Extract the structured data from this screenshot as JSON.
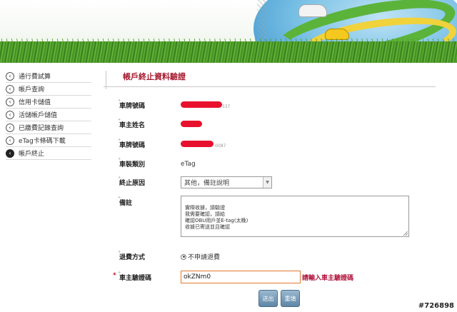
{
  "sidebar": {
    "items": [
      {
        "label": "通行費試算"
      },
      {
        "label": "帳戶查詢"
      },
      {
        "label": "信用卡儲值"
      },
      {
        "label": "活儲帳戶儲值"
      },
      {
        "label": "已繳費記錄查詢"
      },
      {
        "label": "eTag卡條碼下載"
      },
      {
        "label": "帳戶終止",
        "active": true
      }
    ],
    "chevron_icon": "chevron-left-icon"
  },
  "main": {
    "title": "帳戶終止資料驗證",
    "fields": {
      "plate": {
        "label": "車牌號碼",
        "value_tail": "537"
      },
      "owner": {
        "label": "車主姓名"
      },
      "plate2": {
        "label": "車牌號碼",
        "value_tail": "-0087"
      },
      "install": {
        "label": "車裝類別",
        "value": "eTag"
      },
      "reason": {
        "label": "終止原因",
        "selected": "其他，備註說明"
      },
      "remark": {
        "label": "備註",
        "value": "實際收據，請驗證\n我需要確認，請給\n確認OBU用戶並E-tag(太晚)\n收據已寄送並且確認"
      },
      "refund": {
        "label": "退費方式",
        "option": "不申請退費"
      },
      "verify": {
        "label": "車主驗證碼",
        "value": "okZNm0",
        "hint": "請輸入車主驗證碼"
      }
    },
    "buttons": {
      "submit": "送出",
      "reset": "重填"
    }
  },
  "watermark": "#726898",
  "colors": {
    "title": "#a5192e",
    "redaction": "#e8112d",
    "button": "#5f86a6",
    "hint": "#b0123b"
  }
}
